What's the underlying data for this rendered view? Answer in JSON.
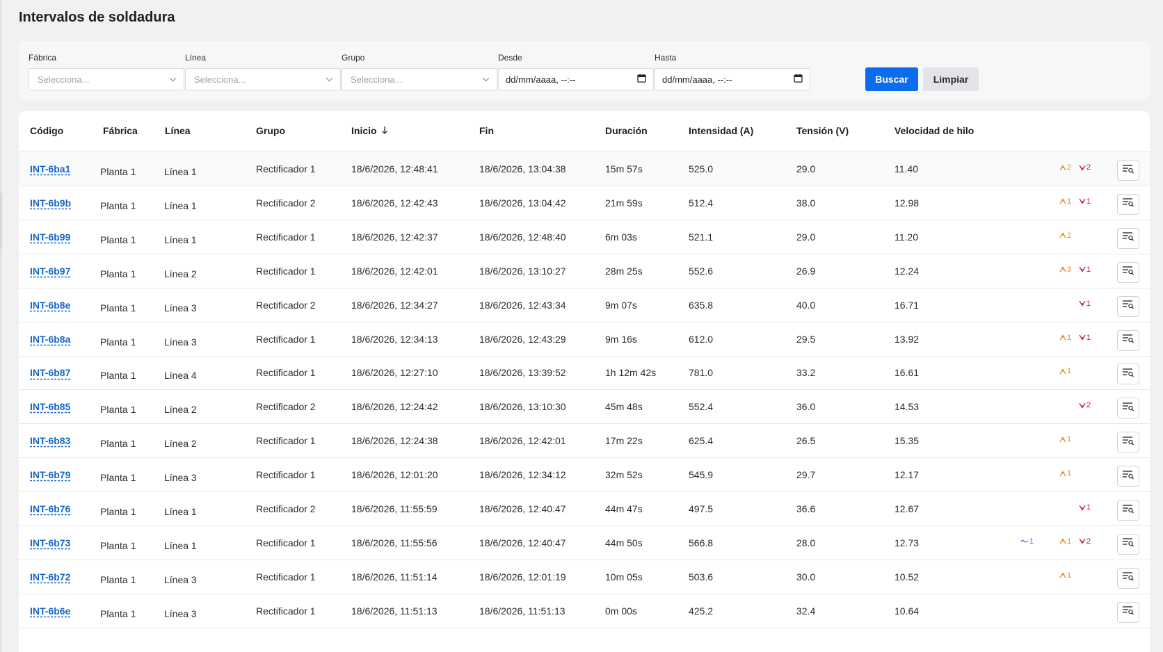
{
  "page": {
    "title": "Intervalos de soldadura"
  },
  "filters": {
    "fabrica": {
      "label": "Fábrica",
      "placeholder": "Selecciona..."
    },
    "linea": {
      "label": "Línea",
      "placeholder": "Selecciona..."
    },
    "grupo": {
      "label": "Grupo",
      "placeholder": "Selecciona..."
    },
    "desde": {
      "label": "Desde",
      "value": "dd/mm/aaaa, --:--"
    },
    "hasta": {
      "label": "Hasta",
      "value": "dd/mm/aaaa, --:--"
    },
    "search_label": "Buscar",
    "clear_label": "Limpiar"
  },
  "table": {
    "columns": {
      "codigo": "Código",
      "fabrica": "Fábrica",
      "linea": "Línea",
      "grupo": "Grupo",
      "inicio": "Inicio",
      "fin": "Fin",
      "duracion": "Duración",
      "intensidad": "Intensidad (A)",
      "tension": "Tensión (V)",
      "velocidad": "Velocidad de hilo"
    },
    "sort": {
      "column": "inicio",
      "direction": "desc",
      "icon": "arrow-down-icon"
    },
    "rows": [
      {
        "code": "INT-6ba1",
        "factory": "Planta 1",
        "line": "Línea 1",
        "group": "Rectificador 1",
        "start": "18/6/2026, 12:48:41",
        "end": "18/6/2026, 13:04:38",
        "duration": "15m 57s",
        "current": "525.0",
        "voltage": "29.0",
        "wire_speed": "11.40",
        "wave": "",
        "up": "2",
        "down": "2"
      },
      {
        "code": "INT-6b9b",
        "factory": "Planta 1",
        "line": "Línea 1",
        "group": "Rectificador 2",
        "start": "18/6/2026, 12:42:43",
        "end": "18/6/2026, 13:04:42",
        "duration": "21m 59s",
        "current": "512.4",
        "voltage": "38.0",
        "wire_speed": "12.98",
        "wave": "",
        "up": "1",
        "down": "1"
      },
      {
        "code": "INT-6b99",
        "factory": "Planta 1",
        "line": "Línea 1",
        "group": "Rectificador 1",
        "start": "18/6/2026, 12:42:37",
        "end": "18/6/2026, 12:48:40",
        "duration": "6m 03s",
        "current": "521.1",
        "voltage": "29.0",
        "wire_speed": "11.20",
        "wave": "",
        "up": "2",
        "down": ""
      },
      {
        "code": "INT-6b97",
        "factory": "Planta 1",
        "line": "Línea 2",
        "group": "Rectificador 1",
        "start": "18/6/2026, 12:42:01",
        "end": "18/6/2026, 13:10:27",
        "duration": "28m 25s",
        "current": "552.6",
        "voltage": "26.9",
        "wire_speed": "12.24",
        "wave": "",
        "up": "3",
        "down": "1"
      },
      {
        "code": "INT-6b8e",
        "factory": "Planta 1",
        "line": "Línea 3",
        "group": "Rectificador 2",
        "start": "18/6/2026, 12:34:27",
        "end": "18/6/2026, 12:43:34",
        "duration": "9m 07s",
        "current": "635.8",
        "voltage": "40.0",
        "wire_speed": "16.71",
        "wave": "",
        "up": "",
        "down": "1"
      },
      {
        "code": "INT-6b8a",
        "factory": "Planta 1",
        "line": "Línea 3",
        "group": "Rectificador 1",
        "start": "18/6/2026, 12:34:13",
        "end": "18/6/2026, 12:43:29",
        "duration": "9m 16s",
        "current": "612.0",
        "voltage": "29.5",
        "wire_speed": "13.92",
        "wave": "",
        "up": "1",
        "down": "1"
      },
      {
        "code": "INT-6b87",
        "factory": "Planta 1",
        "line": "Línea 4",
        "group": "Rectificador 1",
        "start": "18/6/2026, 12:27:10",
        "end": "18/6/2026, 13:39:52",
        "duration": "1h 12m 42s",
        "current": "781.0",
        "voltage": "33.2",
        "wire_speed": "16.61",
        "wave": "",
        "up": "1",
        "down": ""
      },
      {
        "code": "INT-6b85",
        "factory": "Planta 1",
        "line": "Línea 2",
        "group": "Rectificador 2",
        "start": "18/6/2026, 12:24:42",
        "end": "18/6/2026, 13:10:30",
        "duration": "45m 48s",
        "current": "552.4",
        "voltage": "36.0",
        "wire_speed": "14.53",
        "wave": "",
        "up": "",
        "down": "2"
      },
      {
        "code": "INT-6b83",
        "factory": "Planta 1",
        "line": "Línea 2",
        "group": "Rectificador 1",
        "start": "18/6/2026, 12:24:38",
        "end": "18/6/2026, 12:42:01",
        "duration": "17m 22s",
        "current": "625.4",
        "voltage": "26.5",
        "wire_speed": "15.35",
        "wave": "",
        "up": "1",
        "down": ""
      },
      {
        "code": "INT-6b79",
        "factory": "Planta 1",
        "line": "Línea 3",
        "group": "Rectificador 1",
        "start": "18/6/2026, 12:01:20",
        "end": "18/6/2026, 12:34:12",
        "duration": "32m 52s",
        "current": "545.9",
        "voltage": "29.7",
        "wire_speed": "12.17",
        "wave": "",
        "up": "1",
        "down": ""
      },
      {
        "code": "INT-6b76",
        "factory": "Planta 1",
        "line": "Línea 1",
        "group": "Rectificador 2",
        "start": "18/6/2026, 11:55:59",
        "end": "18/6/2026, 12:40:47",
        "duration": "44m 47s",
        "current": "497.5",
        "voltage": "36.6",
        "wire_speed": "12.67",
        "wave": "",
        "up": "",
        "down": "1"
      },
      {
        "code": "INT-6b73",
        "factory": "Planta 1",
        "line": "Línea 1",
        "group": "Rectificador 1",
        "start": "18/6/2026, 11:55:56",
        "end": "18/6/2026, 12:40:47",
        "duration": "44m 50s",
        "current": "566.8",
        "voltage": "28.0",
        "wire_speed": "12.73",
        "wave": "1",
        "up": "1",
        "down": "2"
      },
      {
        "code": "INT-6b72",
        "factory": "Planta 1",
        "line": "Línea 3",
        "group": "Rectificador 1",
        "start": "18/6/2026, 11:51:14",
        "end": "18/6/2026, 12:01:19",
        "duration": "10m 05s",
        "current": "503.6",
        "voltage": "30.0",
        "wire_speed": "10.52",
        "wave": "",
        "up": "1",
        "down": ""
      },
      {
        "code": "INT-6b6e",
        "factory": "Planta 1",
        "line": "Línea 3",
        "group": "Rectificador 1",
        "start": "18/6/2026, 11:51:13",
        "end": "18/6/2026, 11:51:13",
        "duration": "0m 00s",
        "current": "425.2",
        "voltage": "32.4",
        "wire_speed": "10.64",
        "wave": "",
        "up": "",
        "down": ""
      }
    ]
  },
  "colors": {
    "primary": "#0b6cf0",
    "link": "#1565c8",
    "peak_up": "#e08a2d",
    "peak_down": "#c8222e",
    "wave": "#2f7be0"
  },
  "icons": {
    "select": "chevron-down-icon",
    "date": "calendar-icon",
    "peak_up": "peak-up-icon",
    "peak_down": "peak-down-icon",
    "wave": "wave-icon",
    "action": "list-search-icon"
  }
}
